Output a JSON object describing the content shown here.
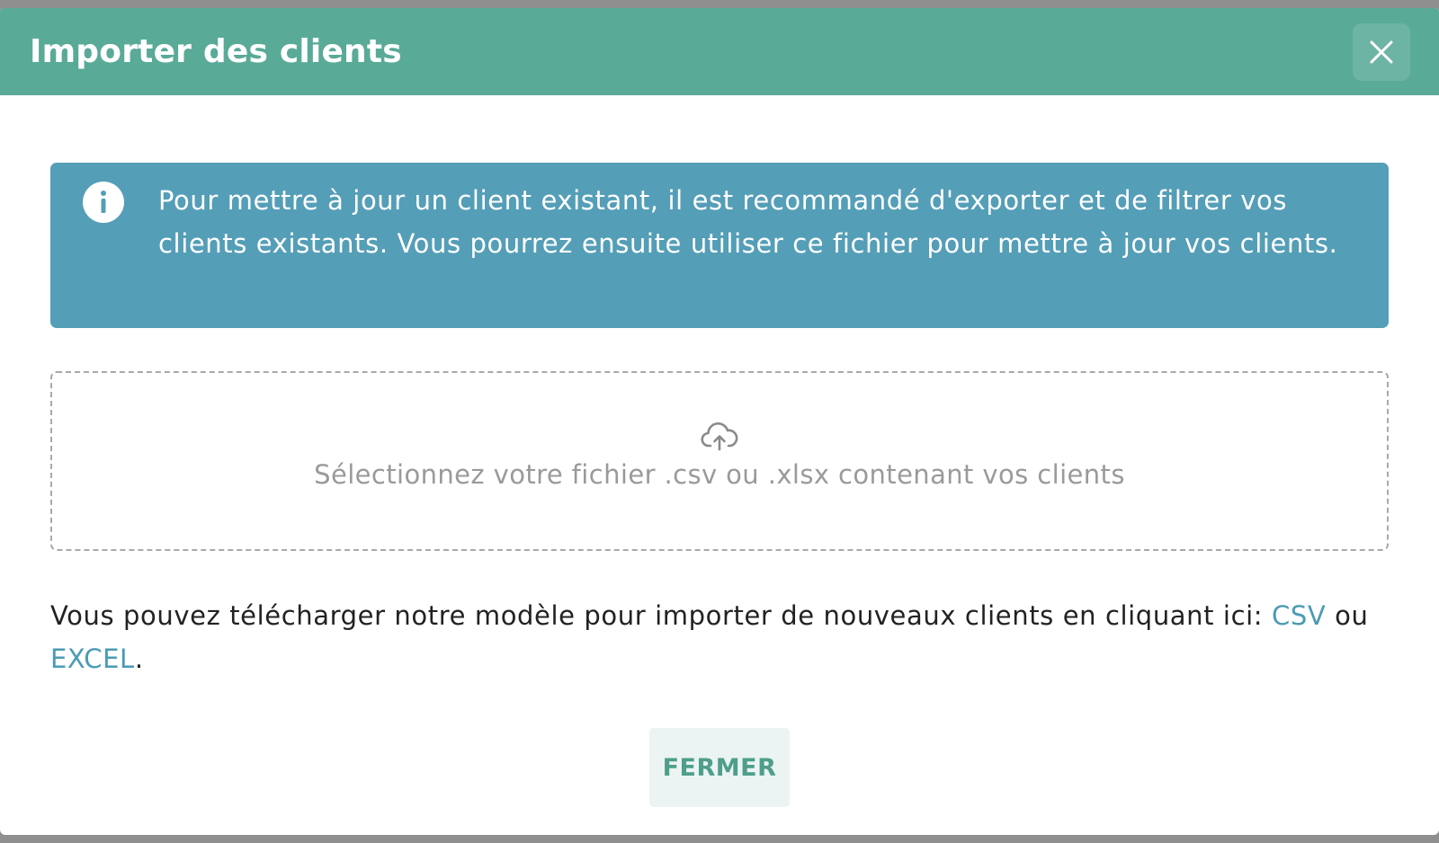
{
  "modal": {
    "title": "Importer des clients",
    "close_icon": "close-icon"
  },
  "info": {
    "icon": "info-icon",
    "text": "Pour mettre à jour un client existant, il est recommandé d'exporter et de filtrer vos clients existants. Vous pourrez ensuite utiliser ce fichier pour mettre à jour vos clients."
  },
  "dropzone": {
    "icon": "cloud-upload-icon",
    "text": "Sélectionnez votre fichier .csv ou .xlsx contenant vos clients"
  },
  "template": {
    "text_before": "Vous pouvez télécharger notre modèle pour importer de nouveaux clients en cliquant ici: ",
    "csv_link": "CSV",
    "separator": " ou ",
    "excel_link": "EXCEL",
    "text_after": "."
  },
  "footer": {
    "close_label": "FERMER"
  },
  "colors": {
    "header": "#5aaa98",
    "info_bg": "#559eb7",
    "link": "#4a9bb4",
    "button_text": "#4f9e8b",
    "button_bg": "#ebf4f2"
  }
}
